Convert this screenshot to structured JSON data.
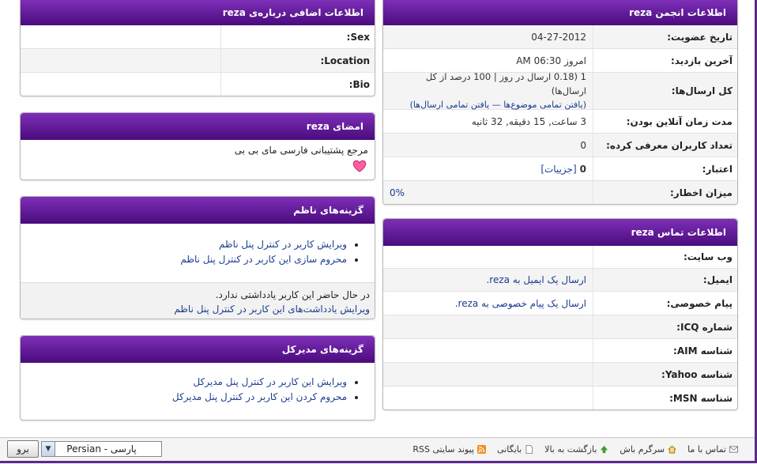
{
  "forum_info": {
    "title": "اطلاعات انجمن reza",
    "rows": [
      {
        "label": "تاریخ عضویت:",
        "value": "04-27-2012"
      },
      {
        "label": "آخرین بازدید:",
        "value": "امروز 06:30 AM"
      },
      {
        "label": "کل ارسال‌ها:",
        "value": "1 (0.18 ارسال در روز | 100 درصد از کل ارسال‌ها)",
        "links": "(یافتن تمامی موضوع‌ها — یافتن تمامی ارسال‌ها)"
      },
      {
        "label": "مدت زمان آنلاین بودن:",
        "value": "3 ساعت, 15 دقیقه, 32 ثانیه"
      },
      {
        "label": "تعداد کاربران معرفی کرده:",
        "value": "0"
      },
      {
        "label": "اعتبار:",
        "value": "0",
        "link": "[جزییات]"
      },
      {
        "label": "میزان اخطار:",
        "value": "0%"
      }
    ]
  },
  "contact_info": {
    "title": "اطلاعات تماس reza",
    "rows": [
      {
        "label": "وب سایت:",
        "value": ""
      },
      {
        "label": "ایمیل:",
        "value": "ارسال یک ایمیل به reza."
      },
      {
        "label": "پیام خصوصی:",
        "value": "ارسال یک پیام خصوصی به reza."
      },
      {
        "label": "شماره ICQ:",
        "value": ""
      },
      {
        "label": "شناسه AIM:",
        "value": ""
      },
      {
        "label": "شناسه Yahoo:",
        "value": ""
      },
      {
        "label": "شناسه MSN:",
        "value": ""
      }
    ]
  },
  "extra_info": {
    "title": "اطلاعات اضافی درباره‌ی reza",
    "rows": [
      {
        "label": "Sex:",
        "value": ""
      },
      {
        "label": "Location:",
        "value": ""
      },
      {
        "label": "Bio:",
        "value": ""
      }
    ]
  },
  "signature": {
    "title": "امضای reza",
    "text": "مرجع پشتیبانی فارسی مای بی بی"
  },
  "moderator_options": {
    "title": "گزینه‌های ناظم",
    "items": [
      "ویرایش کاربر در کنترل پنل ناظم",
      "محروم سازی این کاربر در کنترل پنل ناظم"
    ],
    "note": "در حال حاضر این کاربر یادداشتی ندارد.",
    "note_link": "ویرایش یادداشت‌های این کاربر در کنترل پنل ناظم"
  },
  "admin_options": {
    "title": "گزینه‌های مدیرکل",
    "items": [
      "ویرایش این کاربر در کنترل پنل مدیرکل",
      "محروم کردن این کاربر در کنترل پنل مدیرکل"
    ]
  },
  "footer": {
    "links": [
      "تماس با ما",
      "سرگرم باش",
      "بازگشت به بالا",
      "بایگانی",
      "پیوند سایتی RSS"
    ],
    "language": "پارسی - Persian",
    "go": "برو"
  },
  "colors": {
    "header_top": "#7e2fb8",
    "header_bottom": "#4a0b7d",
    "link": "#1a3d8f"
  }
}
